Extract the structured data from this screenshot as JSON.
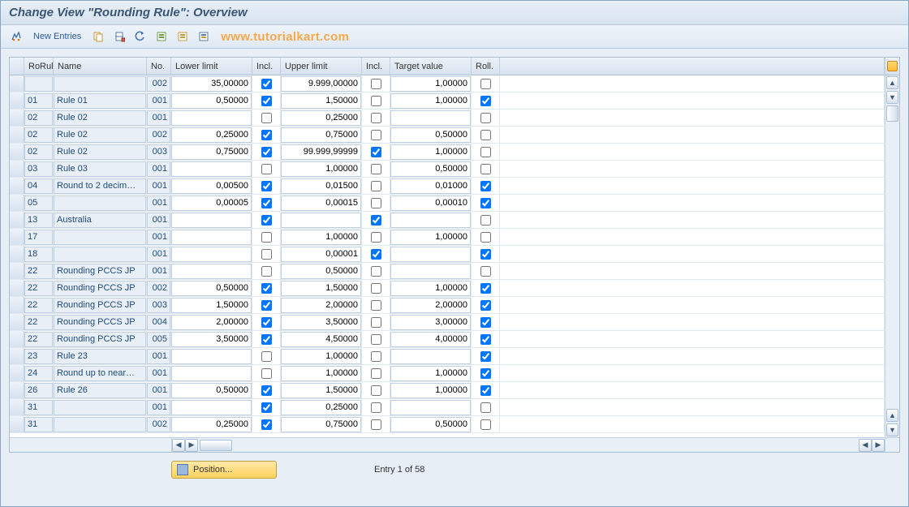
{
  "title": "Change View \"Rounding Rule\": Overview",
  "toolbar": {
    "new_entries_label": "New Entries",
    "watermark": "www.tutorialkart.com"
  },
  "columns": {
    "rorul": "RoRul",
    "name": "Name",
    "no": "No.",
    "lower": "Lower limit",
    "incl1": "Incl.",
    "upper": "Upper limit",
    "incl2": "Incl.",
    "target": "Target value",
    "roll": "Roll."
  },
  "rows": [
    {
      "rorul": "",
      "name": "",
      "no": "002",
      "lower": "35,00000",
      "incl1": true,
      "upper": "9.999,00000",
      "incl2": false,
      "target": "1,00000",
      "roll": false
    },
    {
      "rorul": "01",
      "name": "Rule 01",
      "no": "001",
      "lower": "0,50000",
      "incl1": true,
      "upper": "1,50000",
      "incl2": false,
      "target": "1,00000",
      "roll": true
    },
    {
      "rorul": "02",
      "name": "Rule 02",
      "no": "001",
      "lower": "",
      "incl1": false,
      "upper": "0,25000",
      "incl2": false,
      "target": "",
      "roll": false
    },
    {
      "rorul": "02",
      "name": "Rule 02",
      "no": "002",
      "lower": "0,25000",
      "incl1": true,
      "upper": "0,75000",
      "incl2": false,
      "target": "0,50000",
      "roll": false
    },
    {
      "rorul": "02",
      "name": "Rule 02",
      "no": "003",
      "lower": "0,75000",
      "incl1": true,
      "upper": "99.999,99999",
      "incl2": true,
      "target": "1,00000",
      "roll": false
    },
    {
      "rorul": "03",
      "name": "Rule 03",
      "no": "001",
      "lower": "",
      "incl1": false,
      "upper": "1,00000",
      "incl2": false,
      "target": "0,50000",
      "roll": false
    },
    {
      "rorul": "04",
      "name": "Round to 2 decim…",
      "no": "001",
      "lower": "0,00500",
      "incl1": true,
      "upper": "0,01500",
      "incl2": false,
      "target": "0,01000",
      "roll": true
    },
    {
      "rorul": "05",
      "name": "",
      "no": "001",
      "lower": "0,00005",
      "incl1": true,
      "upper": "0,00015",
      "incl2": false,
      "target": "0,00010",
      "roll": true
    },
    {
      "rorul": "13",
      "name": "Australia",
      "no": "001",
      "lower": "",
      "incl1": true,
      "upper": "",
      "incl2": true,
      "target": "",
      "roll": false
    },
    {
      "rorul": "17",
      "name": "",
      "no": "001",
      "lower": "",
      "incl1": false,
      "upper": "1,00000",
      "incl2": false,
      "target": "1,00000",
      "roll": false
    },
    {
      "rorul": "18",
      "name": "",
      "no": "001",
      "lower": "",
      "incl1": false,
      "upper": "0,00001",
      "incl2": true,
      "target": "",
      "roll": true
    },
    {
      "rorul": "22",
      "name": "Rounding PCCS JP",
      "no": "001",
      "lower": "",
      "incl1": false,
      "upper": "0,50000",
      "incl2": false,
      "target": "",
      "roll": false
    },
    {
      "rorul": "22",
      "name": "Rounding PCCS JP",
      "no": "002",
      "lower": "0,50000",
      "incl1": true,
      "upper": "1,50000",
      "incl2": false,
      "target": "1,00000",
      "roll": true
    },
    {
      "rorul": "22",
      "name": "Rounding PCCS JP",
      "no": "003",
      "lower": "1,50000",
      "incl1": true,
      "upper": "2,00000",
      "incl2": false,
      "target": "2,00000",
      "roll": true
    },
    {
      "rorul": "22",
      "name": "Rounding PCCS JP",
      "no": "004",
      "lower": "2,00000",
      "incl1": true,
      "upper": "3,50000",
      "incl2": false,
      "target": "3,00000",
      "roll": true
    },
    {
      "rorul": "22",
      "name": "Rounding PCCS JP",
      "no": "005",
      "lower": "3,50000",
      "incl1": true,
      "upper": "4,50000",
      "incl2": false,
      "target": "4,00000",
      "roll": true
    },
    {
      "rorul": "23",
      "name": "Rule 23",
      "no": "001",
      "lower": "",
      "incl1": false,
      "upper": "1,00000",
      "incl2": false,
      "target": "",
      "roll": true
    },
    {
      "rorul": "24",
      "name": "Round up to near…",
      "no": "001",
      "lower": "",
      "incl1": false,
      "upper": "1,00000",
      "incl2": false,
      "target": "1,00000",
      "roll": true
    },
    {
      "rorul": "26",
      "name": "Rule 26",
      "no": "001",
      "lower": "0,50000",
      "incl1": true,
      "upper": "1,50000",
      "incl2": false,
      "target": "1,00000",
      "roll": true
    },
    {
      "rorul": "31",
      "name": "",
      "no": "001",
      "lower": "",
      "incl1": true,
      "upper": "0,25000",
      "incl2": false,
      "target": "",
      "roll": false
    },
    {
      "rorul": "31",
      "name": "",
      "no": "002",
      "lower": "0,25000",
      "incl1": true,
      "upper": "0,75000",
      "incl2": false,
      "target": "0,50000",
      "roll": false
    }
  ],
  "footer": {
    "position_label": "Position...",
    "entry_text": "Entry 1 of 58"
  }
}
